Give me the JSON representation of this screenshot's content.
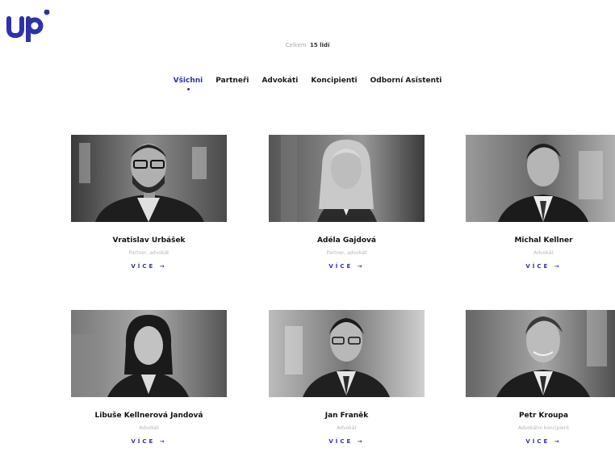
{
  "brand": {
    "logo_text": "up",
    "color": "#2f31a8"
  },
  "total": {
    "label": "Celkem",
    "count": "15 lidí"
  },
  "tabs": [
    {
      "label": "Všichni",
      "active": true
    },
    {
      "label": "Partneři",
      "active": false
    },
    {
      "label": "Advokáti",
      "active": false
    },
    {
      "label": "Koncipienti",
      "active": false
    },
    {
      "label": "Odborní Asistenti",
      "active": false
    }
  ],
  "people": [
    {
      "name": "Vratislav Urbášek",
      "role": "Partner, advokát",
      "more": "VÍCE →"
    },
    {
      "name": "Adéla Gajdová",
      "role": "Partner, advokát",
      "more": "VÍCE →"
    },
    {
      "name": "Michal Kellner",
      "role": "Advokát",
      "more": "VÍCE →"
    },
    {
      "name": "Libuše Kellnerová Jandová",
      "role": "Advokát",
      "more": "VÍCE →"
    },
    {
      "name": "Jan Franěk",
      "role": "Advokát",
      "more": "VÍCE →"
    },
    {
      "name": "Petr Kroupa",
      "role": "Advokátní koncipient",
      "more": "VÍCE →"
    }
  ]
}
